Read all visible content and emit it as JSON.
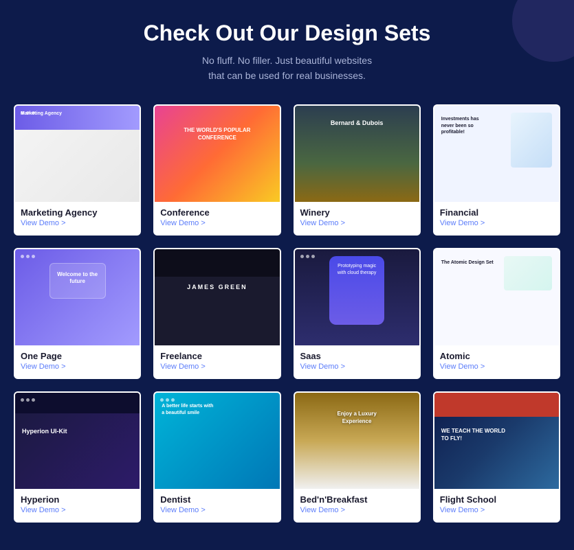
{
  "header": {
    "title": "Check Out Our Design Sets",
    "subtitle_line1": "No fluff. No filler. Just beautiful websites",
    "subtitle_line2": "that can be used for real businesses."
  },
  "cards": [
    {
      "id": "marketing-agency",
      "title": "Marketing Agency",
      "link": "View Demo >",
      "preview_class": "preview-marketing"
    },
    {
      "id": "conference",
      "title": "Conference",
      "link": "View Demo >",
      "preview_class": "preview-conference"
    },
    {
      "id": "winery",
      "title": "Winery",
      "link": "View Demo >",
      "preview_class": "preview-winery"
    },
    {
      "id": "financial",
      "title": "Financial",
      "link": "View Demo >",
      "preview_class": "preview-financial"
    },
    {
      "id": "one-page",
      "title": "One Page",
      "link": "View Demo >",
      "preview_class": "preview-onepage"
    },
    {
      "id": "freelance",
      "title": "Freelance",
      "link": "View Demo >",
      "preview_class": "preview-freelance"
    },
    {
      "id": "saas",
      "title": "Saas",
      "link": "View Demo >",
      "preview_class": "preview-saas"
    },
    {
      "id": "atomic",
      "title": "Atomic",
      "link": "View Demo >",
      "preview_class": "preview-atomic"
    },
    {
      "id": "hyperion",
      "title": "Hyperion",
      "link": "View Demo >",
      "preview_class": "preview-hyperion"
    },
    {
      "id": "dentist",
      "title": "Dentist",
      "link": "View Demo >",
      "preview_class": "preview-dentist"
    },
    {
      "id": "bed-n-breakfast",
      "title": "Bed'n'Breakfast",
      "link": "View Demo >",
      "preview_class": "preview-bnb"
    },
    {
      "id": "flight-school",
      "title": "Flight School",
      "link": "View Demo >",
      "preview_class": "preview-flight"
    }
  ],
  "accent_color": "#5b7cfa",
  "bg_color": "#0d1b4b"
}
